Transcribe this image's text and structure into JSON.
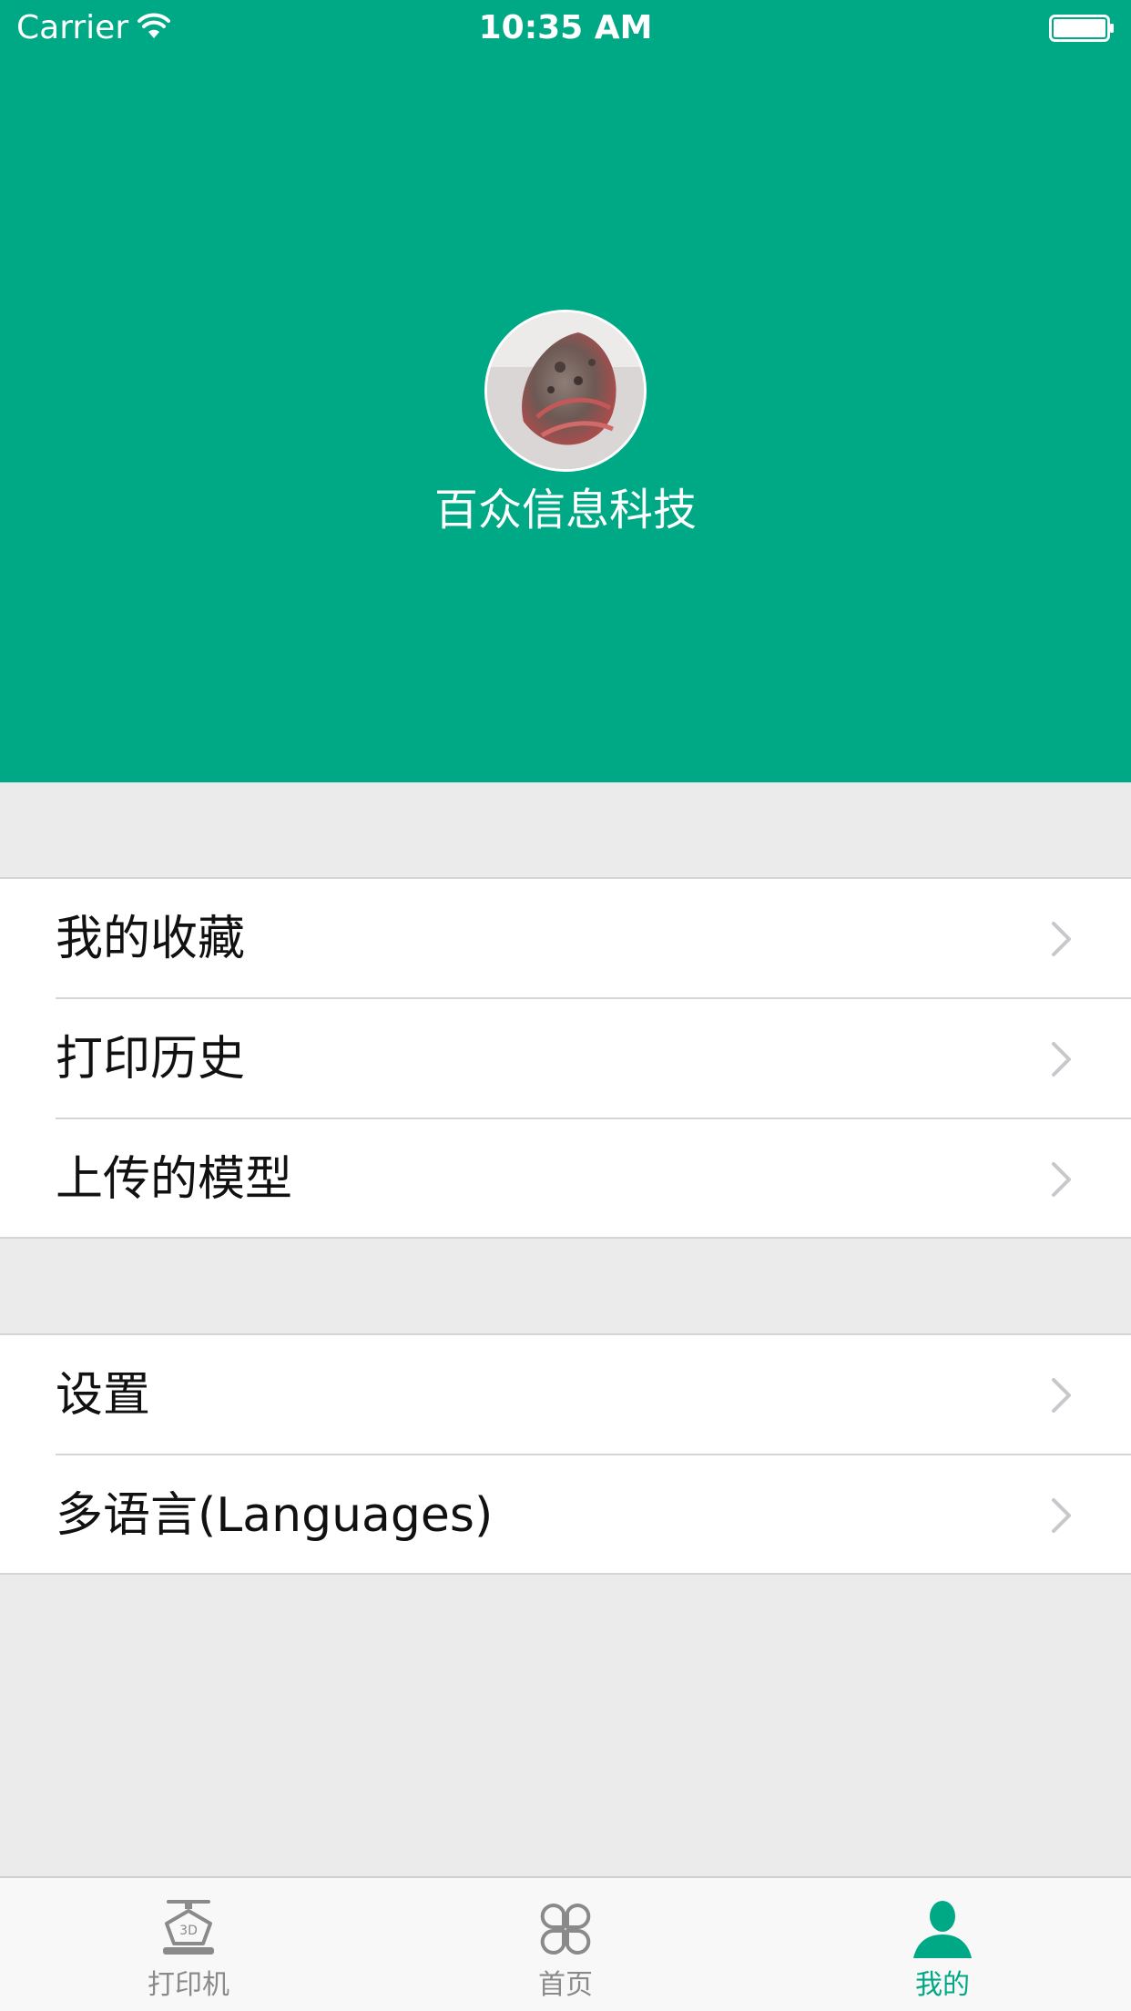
{
  "status_bar": {
    "carrier": "Carrier",
    "time": "10:35 AM",
    "wifi_icon": "wifi-icon",
    "battery_icon": "battery-icon"
  },
  "profile": {
    "name": "百众信息科技",
    "avatar_icon": "avatar-image"
  },
  "menu": {
    "group1": [
      {
        "label": "我的收藏",
        "icon": "chevron-right-icon"
      },
      {
        "label": "打印历史",
        "icon": "chevron-right-icon"
      },
      {
        "label": "上传的模型",
        "icon": "chevron-right-icon"
      }
    ],
    "group2": [
      {
        "label": "设置",
        "icon": "chevron-right-icon"
      },
      {
        "label": "多语言(Languages)",
        "icon": "chevron-right-icon"
      }
    ]
  },
  "tab_bar": {
    "tabs": [
      {
        "label": "打印机",
        "icon": "3d-printer-icon",
        "active": false
      },
      {
        "label": "首页",
        "icon": "home-grid-icon",
        "active": false
      },
      {
        "label": "我的",
        "icon": "user-icon",
        "active": true
      }
    ]
  },
  "colors": {
    "accent": "#00a985",
    "background": "#ebebeb",
    "inactive_tab": "#8a8a8a"
  }
}
